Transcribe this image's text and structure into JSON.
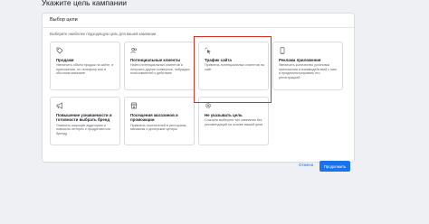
{
  "page": {
    "title": "Укажите цель кампании"
  },
  "panel": {
    "title": "Выбор цели",
    "hint": "Выберите наиболее подходящую цель для вашей кампании"
  },
  "cards": [
    {
      "icon": "tag-icon",
      "title": "Продажи",
      "desc": "Увеличить объем продаж на сайте, в приложении, по телефону или в обычном магазине"
    },
    {
      "icon": "users-icon",
      "title": "Потенциальные клиенты",
      "desc": "Найти потенциальных клиентов и получить другие конверсии, побуждая пользователей к действию"
    },
    {
      "icon": "sparkle-cursor-icon",
      "title": "Трафик сайта",
      "desc": "Привлечь потенциальных клиентов на сайт"
    },
    {
      "icon": "phone-icon",
      "title": "Реклама приложения",
      "desc": "Увеличить количество установок приложения и взаимодействий с ним и продемонстрировать его регистрацией"
    },
    {
      "icon": "megaphone-icon",
      "title": "Повышение узнаваемости и готовности выбрать бренд",
      "desc": "Охватить широкую аудиторию и повысить интерес к продуктам или бренду"
    },
    {
      "icon": "storefront-icon",
      "title": "Посещения магазинов и промоакции",
      "desc": "Привлечь посетителей в рестораны, магазины и дилерские центры"
    },
    {
      "icon": "gear-icon",
      "title": "Не указывать цель",
      "desc": "Сначала выберите тип кампании без рекомендаций на основе вашей цели"
    }
  ],
  "actions": {
    "cancel": "Отмена",
    "continue": "Продолжить"
  },
  "colors": {
    "accent": "#1a73e8",
    "highlight": "#d93025"
  }
}
